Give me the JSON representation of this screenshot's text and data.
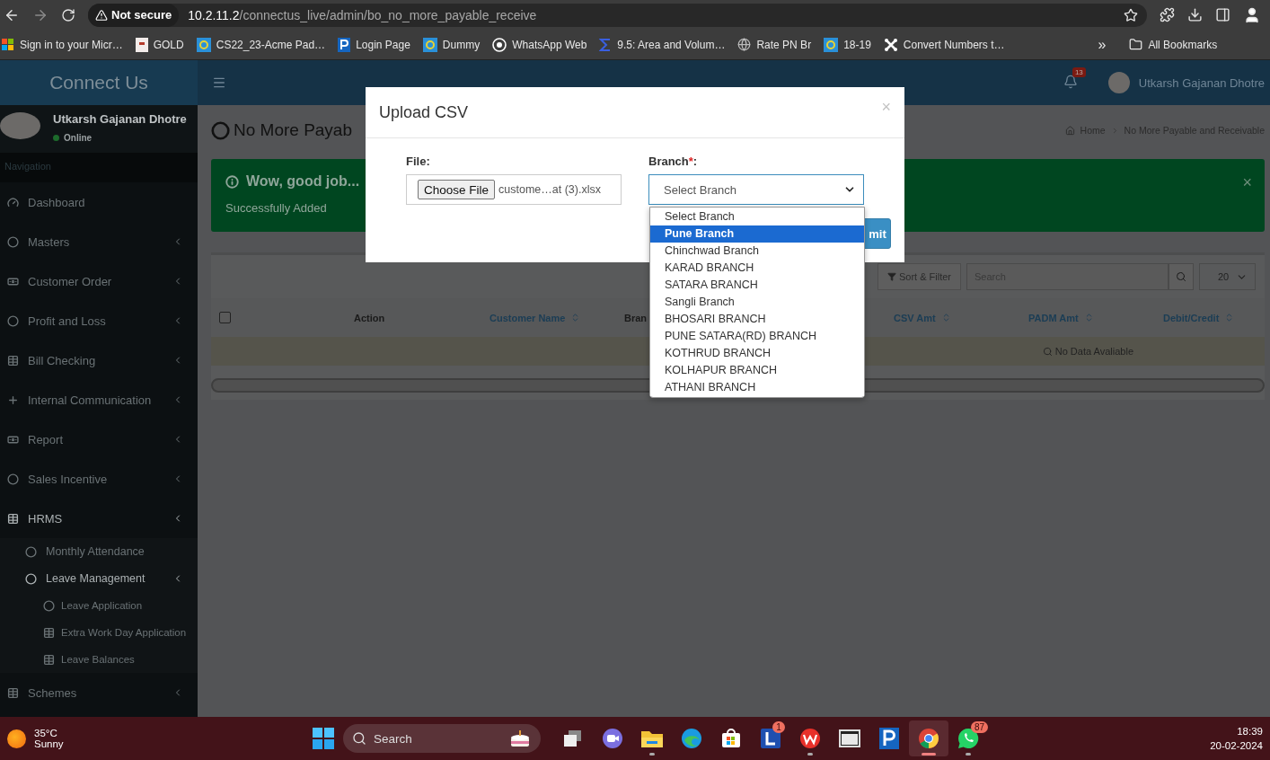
{
  "browser": {
    "security": "Not secure",
    "url_host": "10.2.11.2",
    "url_path": "/connectus_live/admin/bo_no_more_payable_receive",
    "bookmarks": [
      {
        "label": "Sign in to your Micr…"
      },
      {
        "label": "GOLD"
      },
      {
        "label": "CS22_23-Acme Pad…"
      },
      {
        "label": "Login Page"
      },
      {
        "label": "Dummy"
      },
      {
        "label": "WhatsApp Web"
      },
      {
        "label": "9.5: Area and Volum…"
      },
      {
        "label": "Rate PN Br"
      },
      {
        "label": "18-19"
      },
      {
        "label": "Convert Numbers t…"
      }
    ],
    "more": "»",
    "all_bookmarks": "All Bookmarks"
  },
  "app": {
    "logo": "Connect Us",
    "notifications": "13",
    "user_name": "Utkarsh Gajanan Dhotre"
  },
  "sidebar": {
    "user_name": "Utkarsh Gajanan Dhotre",
    "status": "Online",
    "section": "Navigation",
    "items": [
      {
        "label": "Dashboard"
      },
      {
        "label": "Masters",
        "expanded": false
      },
      {
        "label": "Customer Order",
        "expanded": false
      },
      {
        "label": "Profit and Loss",
        "expanded": false
      },
      {
        "label": "Bill Checking",
        "expanded": false
      },
      {
        "label": "Internal Communication",
        "expanded": false
      },
      {
        "label": "Report",
        "expanded": false
      },
      {
        "label": "Sales Incentive",
        "expanded": false
      },
      {
        "label": "HRMS",
        "expanded": true,
        "children": [
          {
            "label": "Monthly Attendance"
          },
          {
            "label": "Leave Management",
            "expanded": true,
            "children": [
              {
                "label": "Leave Application"
              },
              {
                "label": "Extra Work Day Application"
              },
              {
                "label": "Leave Balances"
              }
            ]
          }
        ]
      },
      {
        "label": "Schemes",
        "expanded": false
      }
    ]
  },
  "page": {
    "title": "No More Payab",
    "breadcrumb": [
      "Home",
      "No More Payable and Receivable"
    ],
    "alert": {
      "title": "Wow, good job...",
      "message": "Successfully Added",
      "close": "×"
    },
    "toolbar": {
      "sort_filter": "Sort & Filter",
      "search_placeholder": "Search",
      "page_size": "20"
    },
    "table": {
      "columns": [
        {
          "label": "Action",
          "sortable": false
        },
        {
          "label": "Customer Name",
          "sortable": true
        },
        {
          "label": "Bran",
          "sortable": false
        },
        {
          "label": "CSV Amt",
          "sortable": true
        },
        {
          "label": "PADM Amt",
          "sortable": true
        },
        {
          "label": "Debit/Credit",
          "sortable": true
        }
      ],
      "select_all": {
        "checked": false
      },
      "empty_message": "No Data Avaliable"
    }
  },
  "modal": {
    "title": "Upload CSV",
    "close": "×",
    "file_label": "File:",
    "choose_file": "Choose File",
    "file_name": "custome…at (3).xlsx",
    "branch_label": "Branch",
    "required_mark": "*",
    "branch_suffix": ":",
    "branch_value": "Select Branch",
    "options": [
      {
        "label": "Select Branch",
        "selected": false
      },
      {
        "label": "Pune Branch",
        "selected": true
      },
      {
        "label": "Chinchwad Branch",
        "selected": false
      },
      {
        "label": "KARAD BRANCH",
        "selected": false
      },
      {
        "label": "SATARA BRANCH",
        "selected": false
      },
      {
        "label": "Sangli Branch",
        "selected": false
      },
      {
        "label": "BHOSARI BRANCH",
        "selected": false
      },
      {
        "label": "PUNE SATARA(RD) BRANCH",
        "selected": false
      },
      {
        "label": "KOTHRUD BRANCH",
        "selected": false
      },
      {
        "label": "KOLHAPUR BRANCH",
        "selected": false
      },
      {
        "label": "ATHANI BRANCH",
        "selected": false
      }
    ],
    "submit": "mit"
  },
  "taskbar": {
    "temperature": "35°C",
    "weather": "Sunny",
    "search_placeholder": "Search",
    "apps": [
      {
        "running": false,
        "active": false
      },
      {
        "running": false,
        "active": false
      },
      {
        "running": true,
        "active": false
      },
      {
        "running": false,
        "active": false
      },
      {
        "running": false,
        "active": false
      },
      {
        "running": false,
        "active": false,
        "badge": "1"
      },
      {
        "running": true,
        "active": false
      },
      {
        "running": false,
        "active": false
      },
      {
        "running": false,
        "active": false
      },
      {
        "running": true,
        "active": true
      },
      {
        "running": true,
        "active": false,
        "badge": "87"
      }
    ],
    "time": "18:39",
    "date": "20-02-2024"
  }
}
